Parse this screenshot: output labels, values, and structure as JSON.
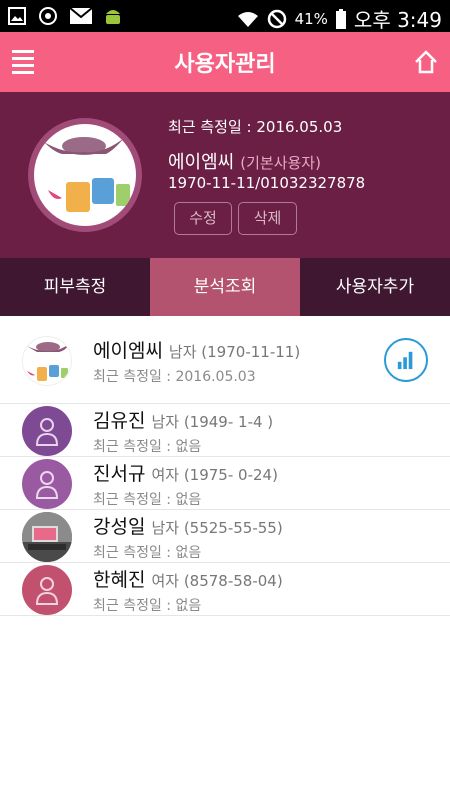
{
  "status": {
    "battery": "41%",
    "time": "오후 3:49",
    "icons": [
      "gallery-icon",
      "sync-icon",
      "mail-icon",
      "android-icon",
      "wifi-icon",
      "block-icon",
      "battery-icon"
    ]
  },
  "header": {
    "title": "사용자관리",
    "menu_icon": "menu-icon",
    "home_icon": "home-icon"
  },
  "profile": {
    "last_date": "최근 측정일 : 2016.05.03",
    "name": "에이엠씨",
    "name_sub": "(기본사용자)",
    "id": "1970-11-11/01032327878",
    "edit_label": "수정",
    "delete_label": "삭제"
  },
  "tabs": [
    {
      "label": "피부측정"
    },
    {
      "label": "분석조회",
      "active": true
    },
    {
      "label": "사용자추가"
    }
  ],
  "users": [
    {
      "name": "에이엠씨",
      "meta": "남자 (1970-11-11)",
      "date": "최근 측정일 : 2016.05.03"
    },
    {
      "name": "김유진",
      "meta": "남자 (1949- 1-4 )",
      "date": "최근 측정일 : 없음"
    },
    {
      "name": "진서규",
      "meta": "여자 (1975- 0-24)",
      "date": "최근 측정일 : 없음"
    },
    {
      "name": "강성일",
      "meta": "남자 (5525-55-55)",
      "date": "최근 측정일 : 없음"
    },
    {
      "name": "한혜진",
      "meta": "여자 (8578-58-04)",
      "date": "최근 측정일 : 없음"
    }
  ],
  "colors": {
    "header": "#f56083",
    "profile_bg": "#6b1f45",
    "tab_bg": "#3f1731",
    "tab_active": "#b4536f",
    "chart_accent": "#2a9ad6"
  }
}
